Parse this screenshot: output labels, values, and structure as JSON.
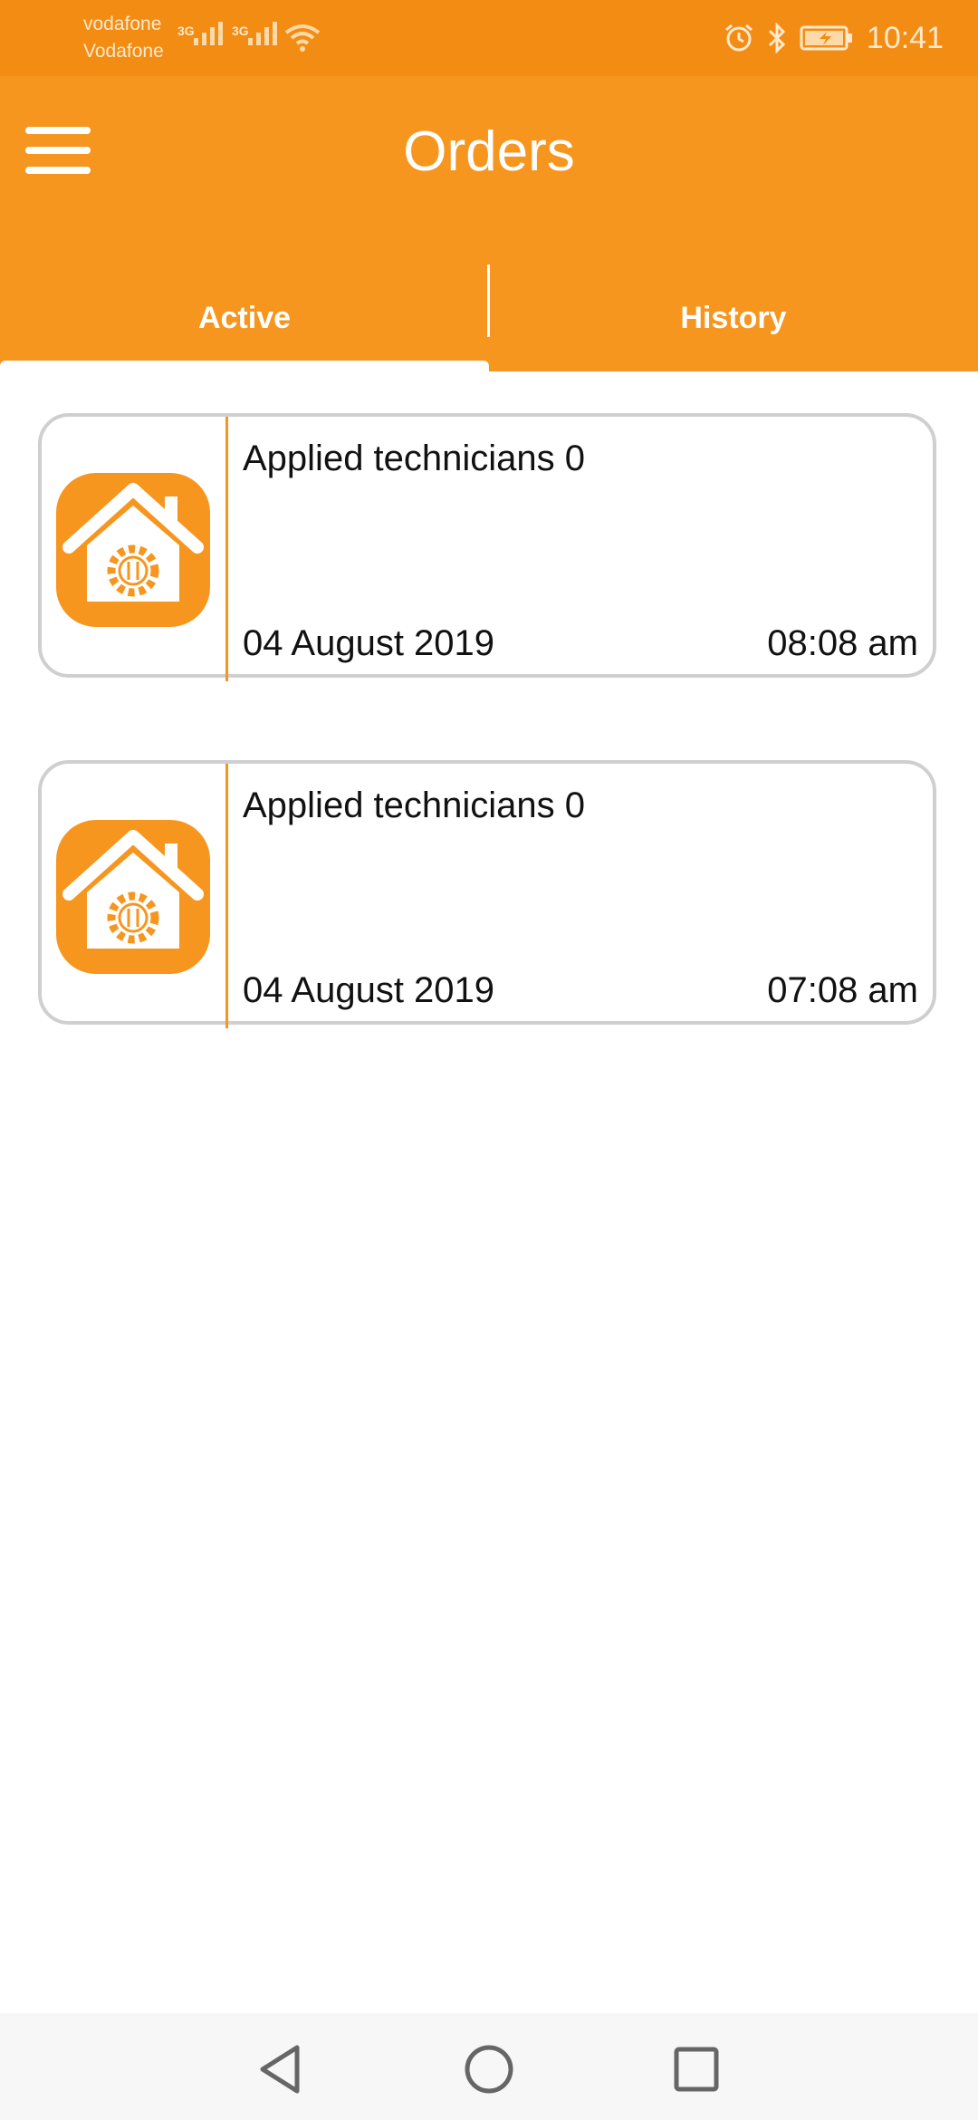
{
  "status_bar": {
    "carrier_1": "vodafone",
    "carrier_2": "Vodafone",
    "network_type_1": "3G",
    "network_type_2": "3G",
    "time": "10:41",
    "icons": [
      "signal-icon",
      "signal-icon",
      "wifi-icon",
      "alarm-icon",
      "bluetooth-icon",
      "battery-charging-icon"
    ]
  },
  "app_bar": {
    "title": "Orders",
    "menu_icon": "hamburger-menu-icon",
    "background_color": "#F6961F"
  },
  "tabs": [
    {
      "label": "Active",
      "selected": true
    },
    {
      "label": "History",
      "selected": false
    }
  ],
  "orders": [
    {
      "title": "Applied technicians 0",
      "date": "04 August 2019",
      "time": "08:08 am",
      "icon": "house-gear-icon"
    },
    {
      "title": "Applied technicians 0",
      "date": "04 August 2019",
      "time": "07:08 am",
      "icon": "house-gear-icon"
    }
  ],
  "nav_bar": {
    "icons": [
      "back-icon",
      "home-icon",
      "recents-icon"
    ]
  },
  "colors": {
    "accent": "#F6961F",
    "status_bar": "#F28C13",
    "card_border": "#cfcfcf"
  }
}
